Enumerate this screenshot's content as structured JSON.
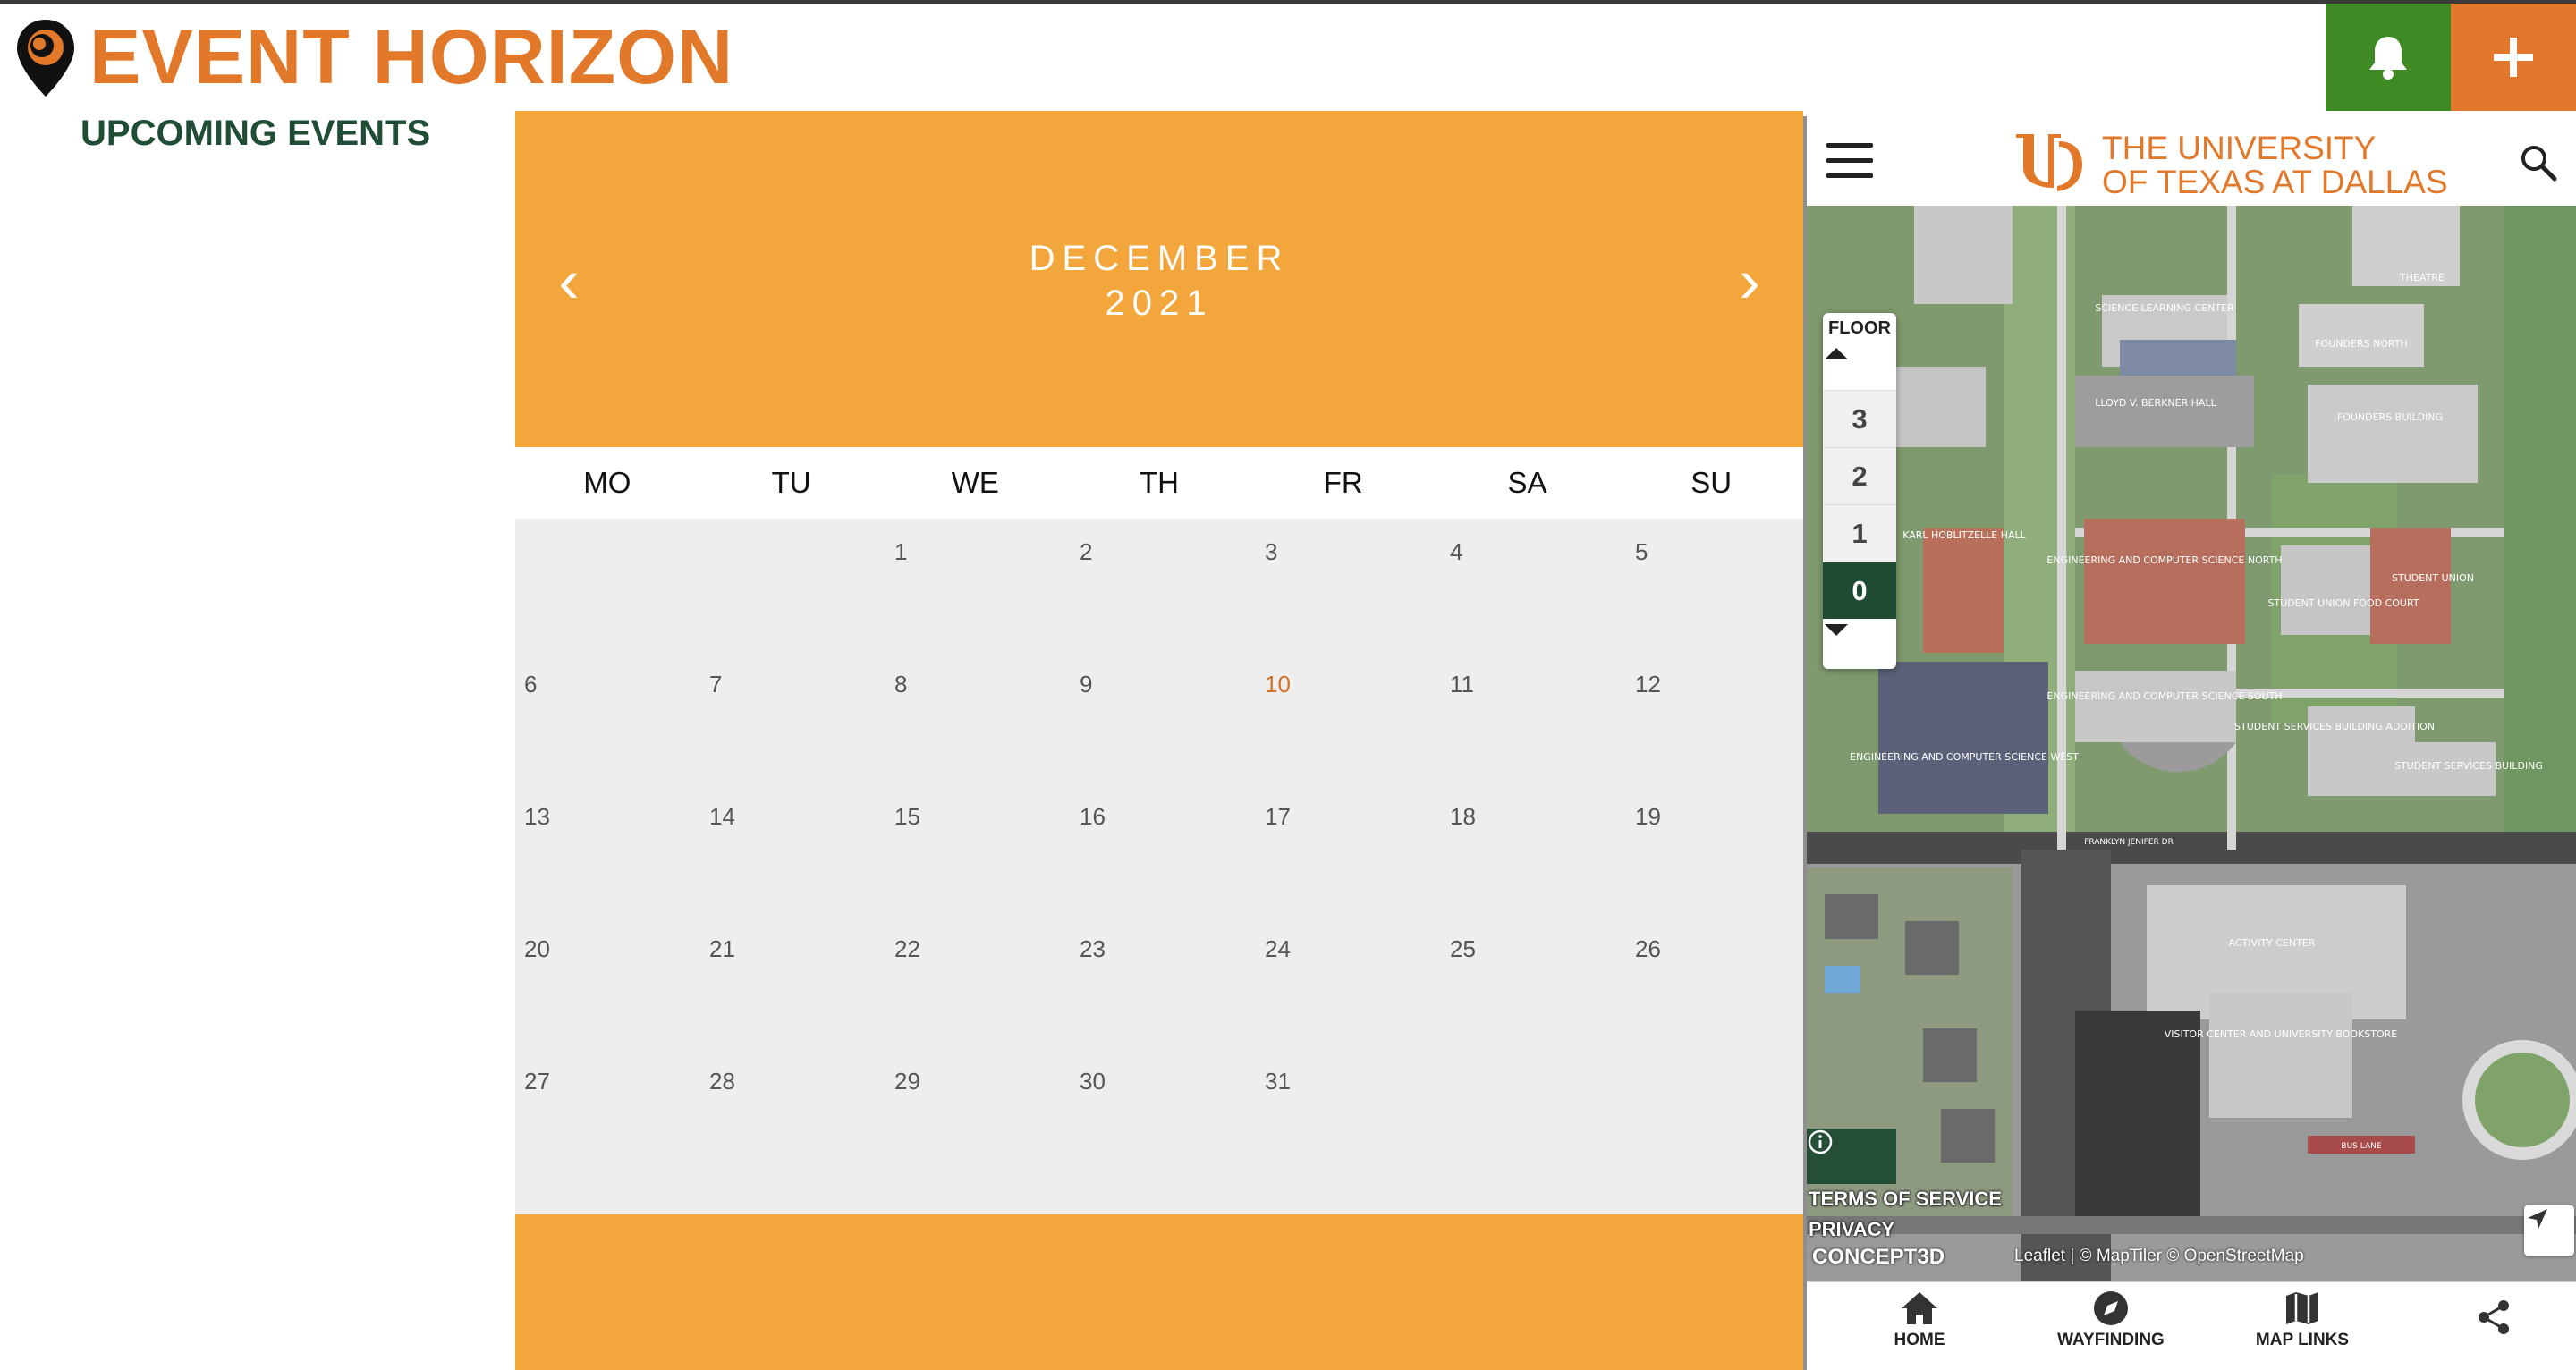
{
  "header": {
    "app_title": "EVENT HORIZON",
    "subtitle": "UPCOMING EVENTS",
    "logo_icon": "map-pin-icon",
    "bell_icon": "bell-icon",
    "add_icon": "plus-icon"
  },
  "calendar": {
    "month": "DECEMBER",
    "year": "2021",
    "prev": "‹",
    "next": "›",
    "weekdays": [
      "MO",
      "TU",
      "WE",
      "TH",
      "FR",
      "SA",
      "SU"
    ],
    "days": [
      "1",
      "2",
      "3",
      "4",
      "5",
      "6",
      "7",
      "8",
      "9",
      "10",
      "11",
      "12",
      "13",
      "14",
      "15",
      "16",
      "17",
      "18",
      "19",
      "20",
      "21",
      "22",
      "23",
      "24",
      "25",
      "26",
      "27",
      "28",
      "29",
      "30",
      "31"
    ],
    "today": "10"
  },
  "map": {
    "university_line1": "THE UNIVERSITY",
    "university_line2": "OF TEXAS AT DALLAS",
    "floor_label": "FLOOR",
    "floors": [
      "3",
      "2",
      "1",
      "0"
    ],
    "active_floor": "0",
    "labels": {
      "science_center": "SCIENCE LEARNING CENTER",
      "founders_north": "FOUNDERS NORTH",
      "founders": "FOUNDERS BUILDING",
      "theatre": "THEATRE",
      "berkner": "LLOYD V. BERKNER HALL",
      "ecsn": "ENGINEERING AND COMPUTER SCIENCE NORTH",
      "ecss": "ENGINEERING AND COMPUTER SCIENCE SOUTH",
      "ecsw": "ENGINEERING AND COMPUTER SCIENCE WEST",
      "student_union": "STUDENT UNION",
      "food_court": "STUDENT UNION FOOD COURT",
      "ssb_addition": "STUDENT SERVICES BUILDING ADDITION",
      "ssb": "STUDENT SERVICES BUILDING",
      "activity": "ACTIVITY CENTER",
      "visitor": "VISITOR CENTER AND UNIVERSITY BOOKSTORE",
      "hoblitzelle": "KARL HOBLITZELLE HALL",
      "franklyn": "FRANKLYN JENIFER DR",
      "bus_lane": "BUS LANE"
    },
    "links": {
      "terms": "TERMS OF SERVICE",
      "privacy": "PRIVACY"
    },
    "concept": "CONCEPT3D",
    "attribution": "Leaflet  |  © MapTiler © OpenStreetMap"
  },
  "bottom_nav": [
    {
      "label": "HOME",
      "icon": "home-icon"
    },
    {
      "label": "WAYFINDING",
      "icon": "compass-icon"
    },
    {
      "label": "MAP LINKS",
      "icon": "map-icon"
    },
    {
      "label": "",
      "icon": "share-icon"
    }
  ],
  "colors": {
    "orange": "#e2792a",
    "calendar_orange": "#f2a63b",
    "green": "#3f8a25",
    "dark_green": "#1f4a34"
  }
}
